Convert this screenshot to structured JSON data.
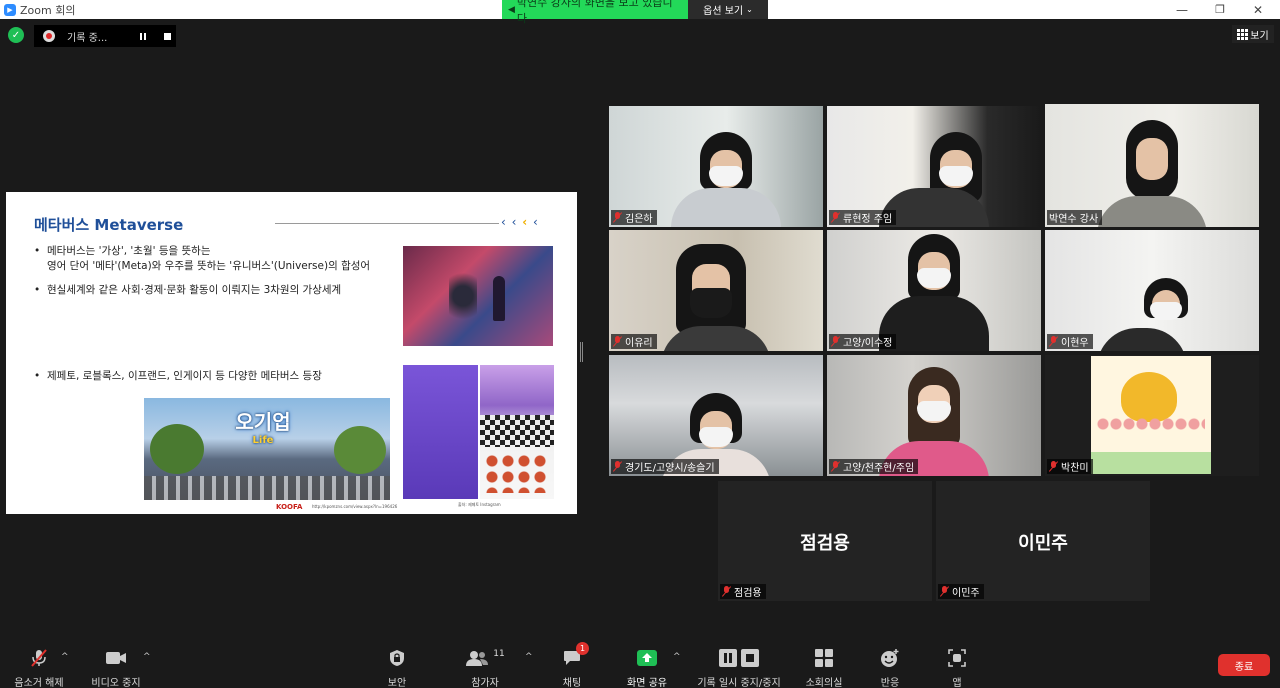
{
  "window": {
    "title": "Zoom 회의",
    "minimize": "—",
    "restore": "❐",
    "close": "✕"
  },
  "share_banner": {
    "text": "박연수 강사의 화면을 보고 있습니다",
    "options": "옵션 보기"
  },
  "recording": {
    "label": "기록 중..."
  },
  "view_button": "보기",
  "slide": {
    "title": "메타버스 Metaverse",
    "arrows": "‹‹‹‹",
    "bullets": [
      "메타버스는 '가상', '초월' 등을 뜻하는",
      "영어 단어 '메타'(Meta)와 우주를 뜻하는 '유니버스'(Universe)의 합성어",
      "현실세계와 같은 사회·경제·문화 활동이 이뤄지는 3차원의 가상세계",
      "제페토, 로블록스, 이프랜드, 인게이지 등 다양한 메타버스 등장"
    ],
    "game_logo": "오기업",
    "game_logo_sub": "Life",
    "brand": "KOOFA",
    "source_url": "http://kpomzns.com/view.aspx?ln=196426",
    "source_url2": "출처: 제페토 Instagram"
  },
  "participants": [
    {
      "name": "김은하",
      "muted": true
    },
    {
      "name": "류현정 주임",
      "muted": true
    },
    {
      "name": "박연수 강사",
      "muted": false,
      "active": true
    },
    {
      "name": "이유리",
      "muted": true
    },
    {
      "name": "고양/이수정",
      "muted": true
    },
    {
      "name": "이현우",
      "muted": true
    },
    {
      "name": "경기도/고양시/송슬기",
      "muted": true
    },
    {
      "name": "고양/천주현/주임",
      "muted": true
    },
    {
      "name": "박찬미",
      "muted": true
    },
    {
      "name": "점검용",
      "muted": true,
      "display": "점검용"
    },
    {
      "name": "이민주",
      "muted": true,
      "display": "이민주"
    }
  ],
  "toolbar": {
    "unmute": "음소거 해제",
    "stop_video": "비디오 중지",
    "security": "보안",
    "participants": "참가자",
    "participants_count": "11",
    "chat": "채팅",
    "chat_badge": "1",
    "share_screen": "화면 공유",
    "pause_stop_recording": "기록 일시 중지/중지",
    "breakout_rooms": "소회의실",
    "reactions": "반응",
    "apps": "앱",
    "end": "종료"
  },
  "colors": {
    "share_banner_green": "#23d959",
    "active_speaker_border": "#c8f07a",
    "end_button": "#e0312d",
    "slide_title_blue": "#1f4f99"
  },
  "icons": [
    "zoom-app-icon",
    "speaker-icon",
    "chevron-down-icon",
    "shield-check-icon",
    "record-icon",
    "pause-icon",
    "stop-icon",
    "grid-view-icon",
    "mic-off-icon",
    "video-icon",
    "security-shield-icon",
    "participants-icon",
    "chat-icon",
    "share-screen-icon",
    "breakout-rooms-icon",
    "reactions-icon",
    "apps-icon"
  ]
}
